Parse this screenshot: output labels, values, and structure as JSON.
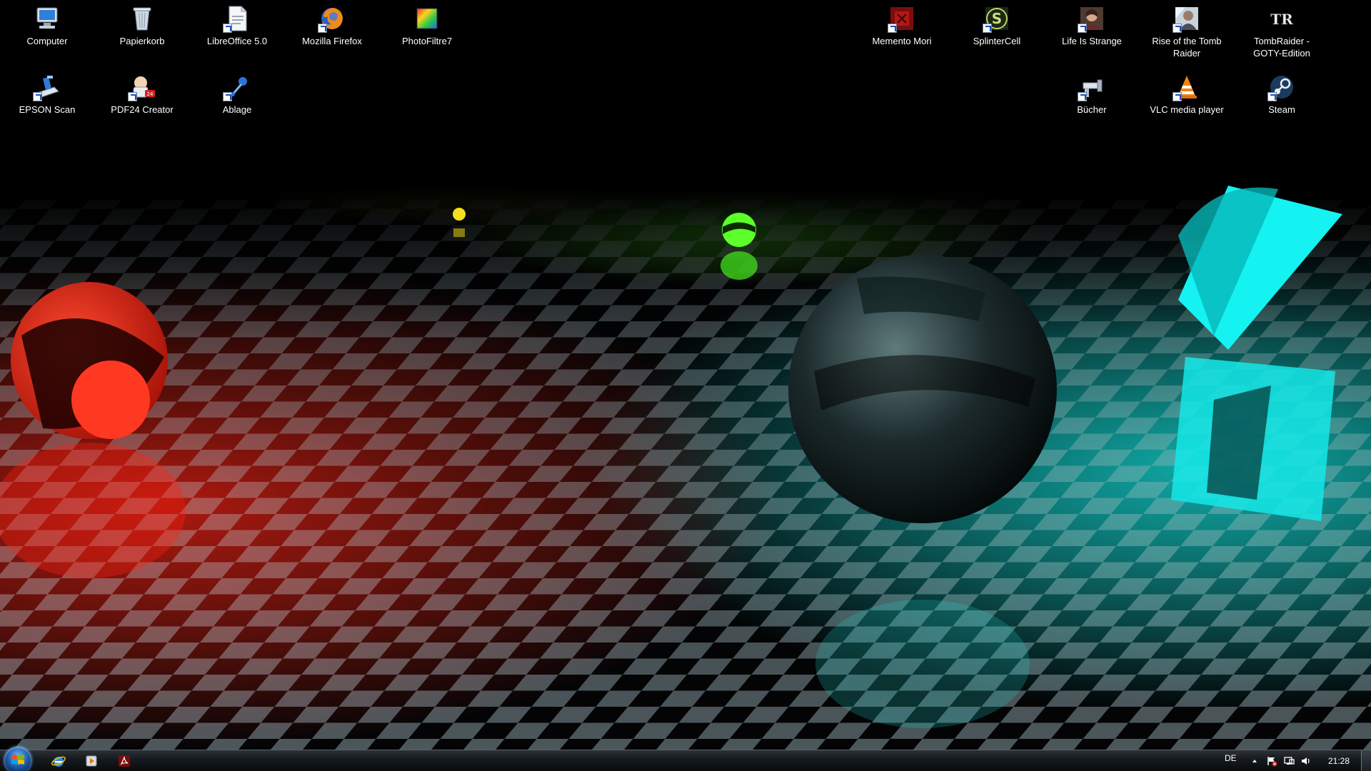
{
  "desktop": {
    "icons_left": [
      {
        "label": "Computer",
        "icon": "computer-icon",
        "shortcut": false
      },
      {
        "label": "Papierkorb",
        "icon": "recycle-bin-icon",
        "shortcut": false
      },
      {
        "label": "LibreOffice 5.0",
        "icon": "libreoffice-icon",
        "shortcut": true
      },
      {
        "label": "Mozilla Firefox",
        "icon": "firefox-icon",
        "shortcut": true
      },
      {
        "label": "PhotoFiltre7",
        "icon": "photofiltre-icon",
        "shortcut": false
      },
      {
        "label": "EPSON Scan",
        "icon": "epson-scan-icon",
        "shortcut": true
      },
      {
        "label": "PDF24 Creator",
        "icon": "pdf24-icon",
        "shortcut": true
      },
      {
        "label": "Ablage",
        "icon": "ablage-icon",
        "shortcut": true
      }
    ],
    "icons_right": [
      {
        "label": "Memento Mori",
        "icon": "memento-mori-icon",
        "shortcut": true
      },
      {
        "label": "SplinterCell",
        "icon": "splintercell-icon",
        "shortcut": true
      },
      {
        "label": "Life Is Strange",
        "icon": "life-is-strange-icon",
        "shortcut": true
      },
      {
        "label": "Rise of the Tomb Raider",
        "icon": "rise-tomb-raider-icon",
        "shortcut": true
      },
      {
        "label": "TombRaider - GOTY-Edition",
        "icon": "tombraider-goty-icon",
        "shortcut": false
      },
      {
        "label": "Bücher",
        "icon": "buecher-icon",
        "shortcut": true
      },
      {
        "label": "VLC media player",
        "icon": "vlc-icon",
        "shortcut": true
      },
      {
        "label": "Steam",
        "icon": "steam-icon",
        "shortcut": true
      }
    ]
  },
  "taskbar": {
    "start": "windows-logo-icon",
    "pinned": [
      "internet-explorer-icon",
      "media-player-icon",
      "acrobat-reader-icon"
    ],
    "tray": {
      "language": "DE",
      "icons": [
        "tray-expand-icon",
        "action-center-flag-icon",
        "network-icon",
        "volume-icon"
      ],
      "clock": "21:28"
    }
  },
  "colors": {
    "red_glow": "#ff2a1a",
    "green_glow": "#5cff2a",
    "cyan_glow": "#15f2f2",
    "yellow_glow": "#f4e01e"
  }
}
